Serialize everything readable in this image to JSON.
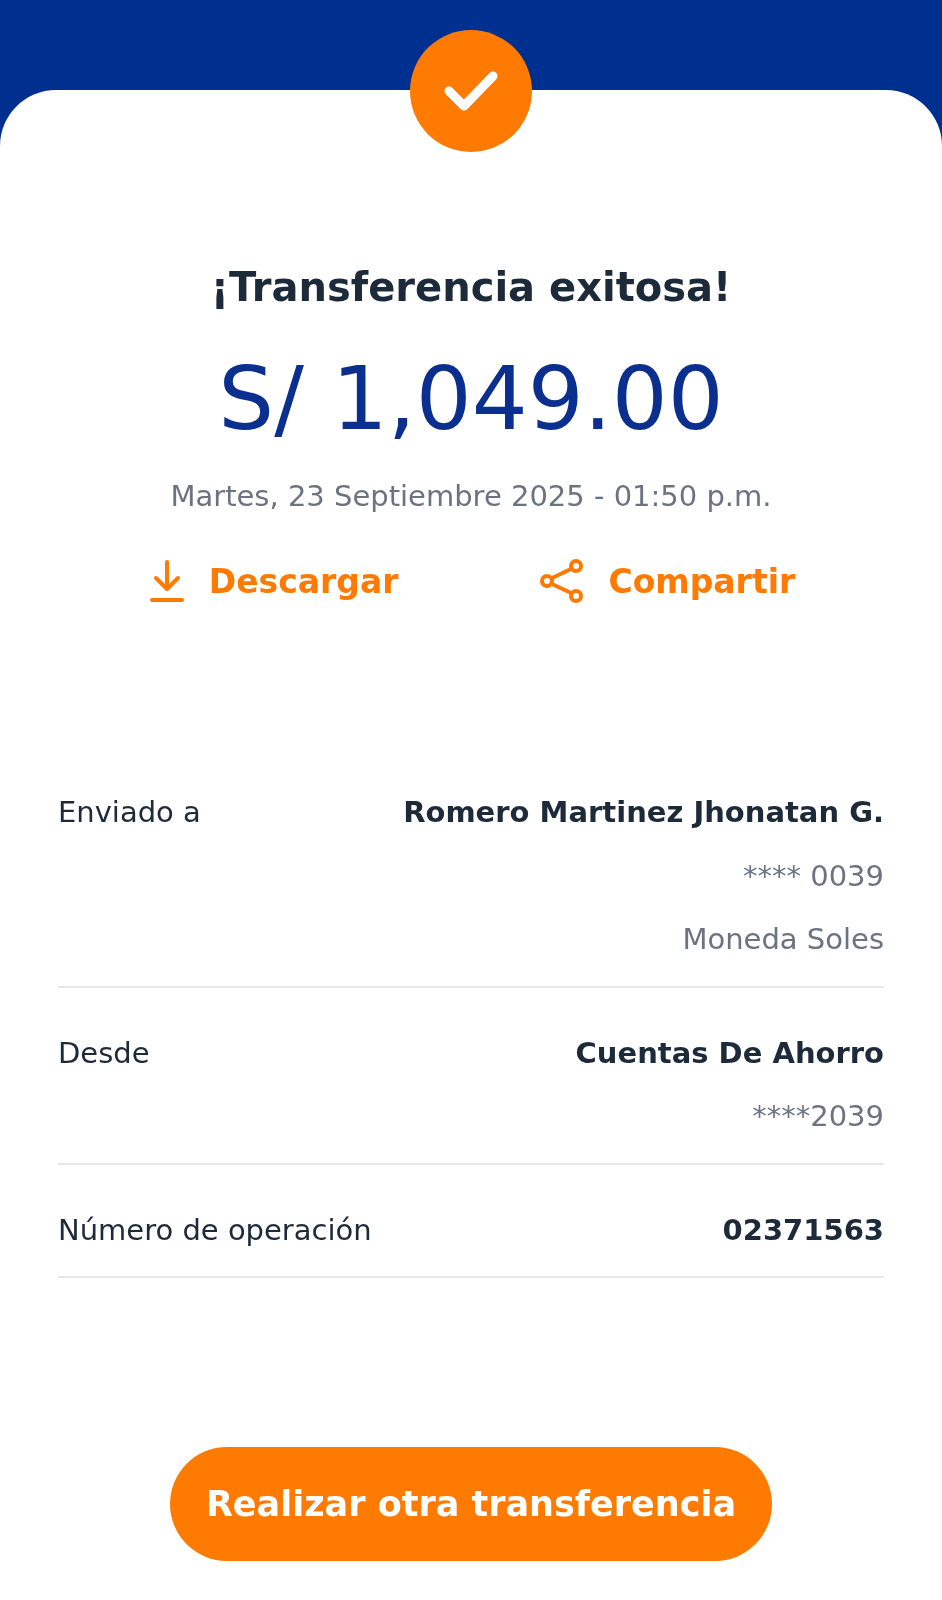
{
  "title": "¡Transferencia exitosa!",
  "amount": "S/ 1,049.00",
  "date": "Martes, 23 Septiembre 2025 - 01:50 p.m.",
  "actions": [
    {
      "kind": "download",
      "label": "Descargar"
    },
    {
      "kind": "share",
      "label": "Compartir"
    }
  ],
  "details": [
    {
      "label": "Enviado a",
      "lines": [
        {
          "text": "Romero Martinez Jhonatan G.",
          "bold": true
        },
        {
          "text": "**** 0039",
          "bold": false
        },
        {
          "text": "Moneda Soles",
          "bold": false
        }
      ]
    },
    {
      "label": "Desde",
      "lines": [
        {
          "text": "Cuentas De Ahorro",
          "bold": true
        },
        {
          "text": "****2039",
          "bold": false
        }
      ]
    },
    {
      "label": "Número de operación",
      "lines": [
        {
          "text": "02371563",
          "bold": true
        }
      ]
    }
  ],
  "button": "Realizar otra transferencia"
}
